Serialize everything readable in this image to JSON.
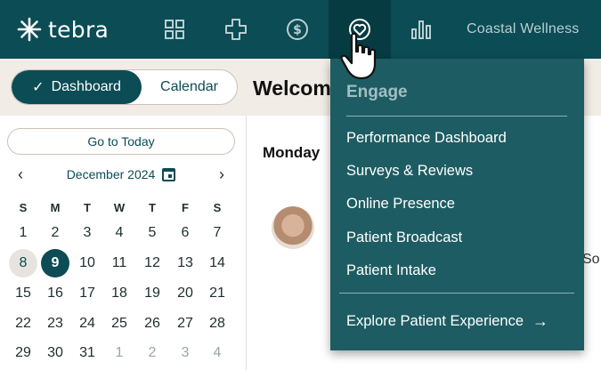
{
  "app": {
    "logo_text": "tebra",
    "practice_name": "Coastal Wellness"
  },
  "nav": {
    "icons": [
      "grid-icon",
      "plus-icon",
      "dollar-icon",
      "heart-icon",
      "bar-chart-icon"
    ],
    "active": "heart-icon"
  },
  "header": {
    "toggle": {
      "dashboard": "Dashboard",
      "calendar": "Calendar",
      "selected": "Dashboard"
    },
    "welcome": "Welcom"
  },
  "calendar": {
    "go_today": "Go to Today",
    "month_label": "December 2024",
    "prev": "‹",
    "next": "›",
    "weekdays": [
      "S",
      "M",
      "T",
      "W",
      "T",
      "F",
      "S"
    ],
    "weeks": [
      [
        "1",
        "2",
        "3",
        "4",
        "5",
        "6",
        "7"
      ],
      [
        "8",
        "9",
        "10",
        "11",
        "12",
        "13",
        "14"
      ],
      [
        "15",
        "16",
        "17",
        "18",
        "19",
        "20",
        "21"
      ],
      [
        "22",
        "23",
        "24",
        "25",
        "26",
        "27",
        "28"
      ],
      [
        "29",
        "30",
        "31",
        "1",
        "2",
        "3",
        "4"
      ]
    ],
    "selected_day": "9",
    "hover_day": "8"
  },
  "main": {
    "date_heading": "Monday",
    "partial_text": "So"
  },
  "dropdown": {
    "title": "Engage",
    "items": [
      "Performance Dashboard",
      "Surveys & Reviews",
      "Online Presence",
      "Patient Broadcast",
      "Patient Intake"
    ],
    "explore": "Explore Patient Experience",
    "explore_arrow": "→"
  },
  "colors": {
    "brand_dark": "#0b4c55",
    "dropdown_bg": "#1d5c62",
    "header_bg": "#f1ece6"
  }
}
